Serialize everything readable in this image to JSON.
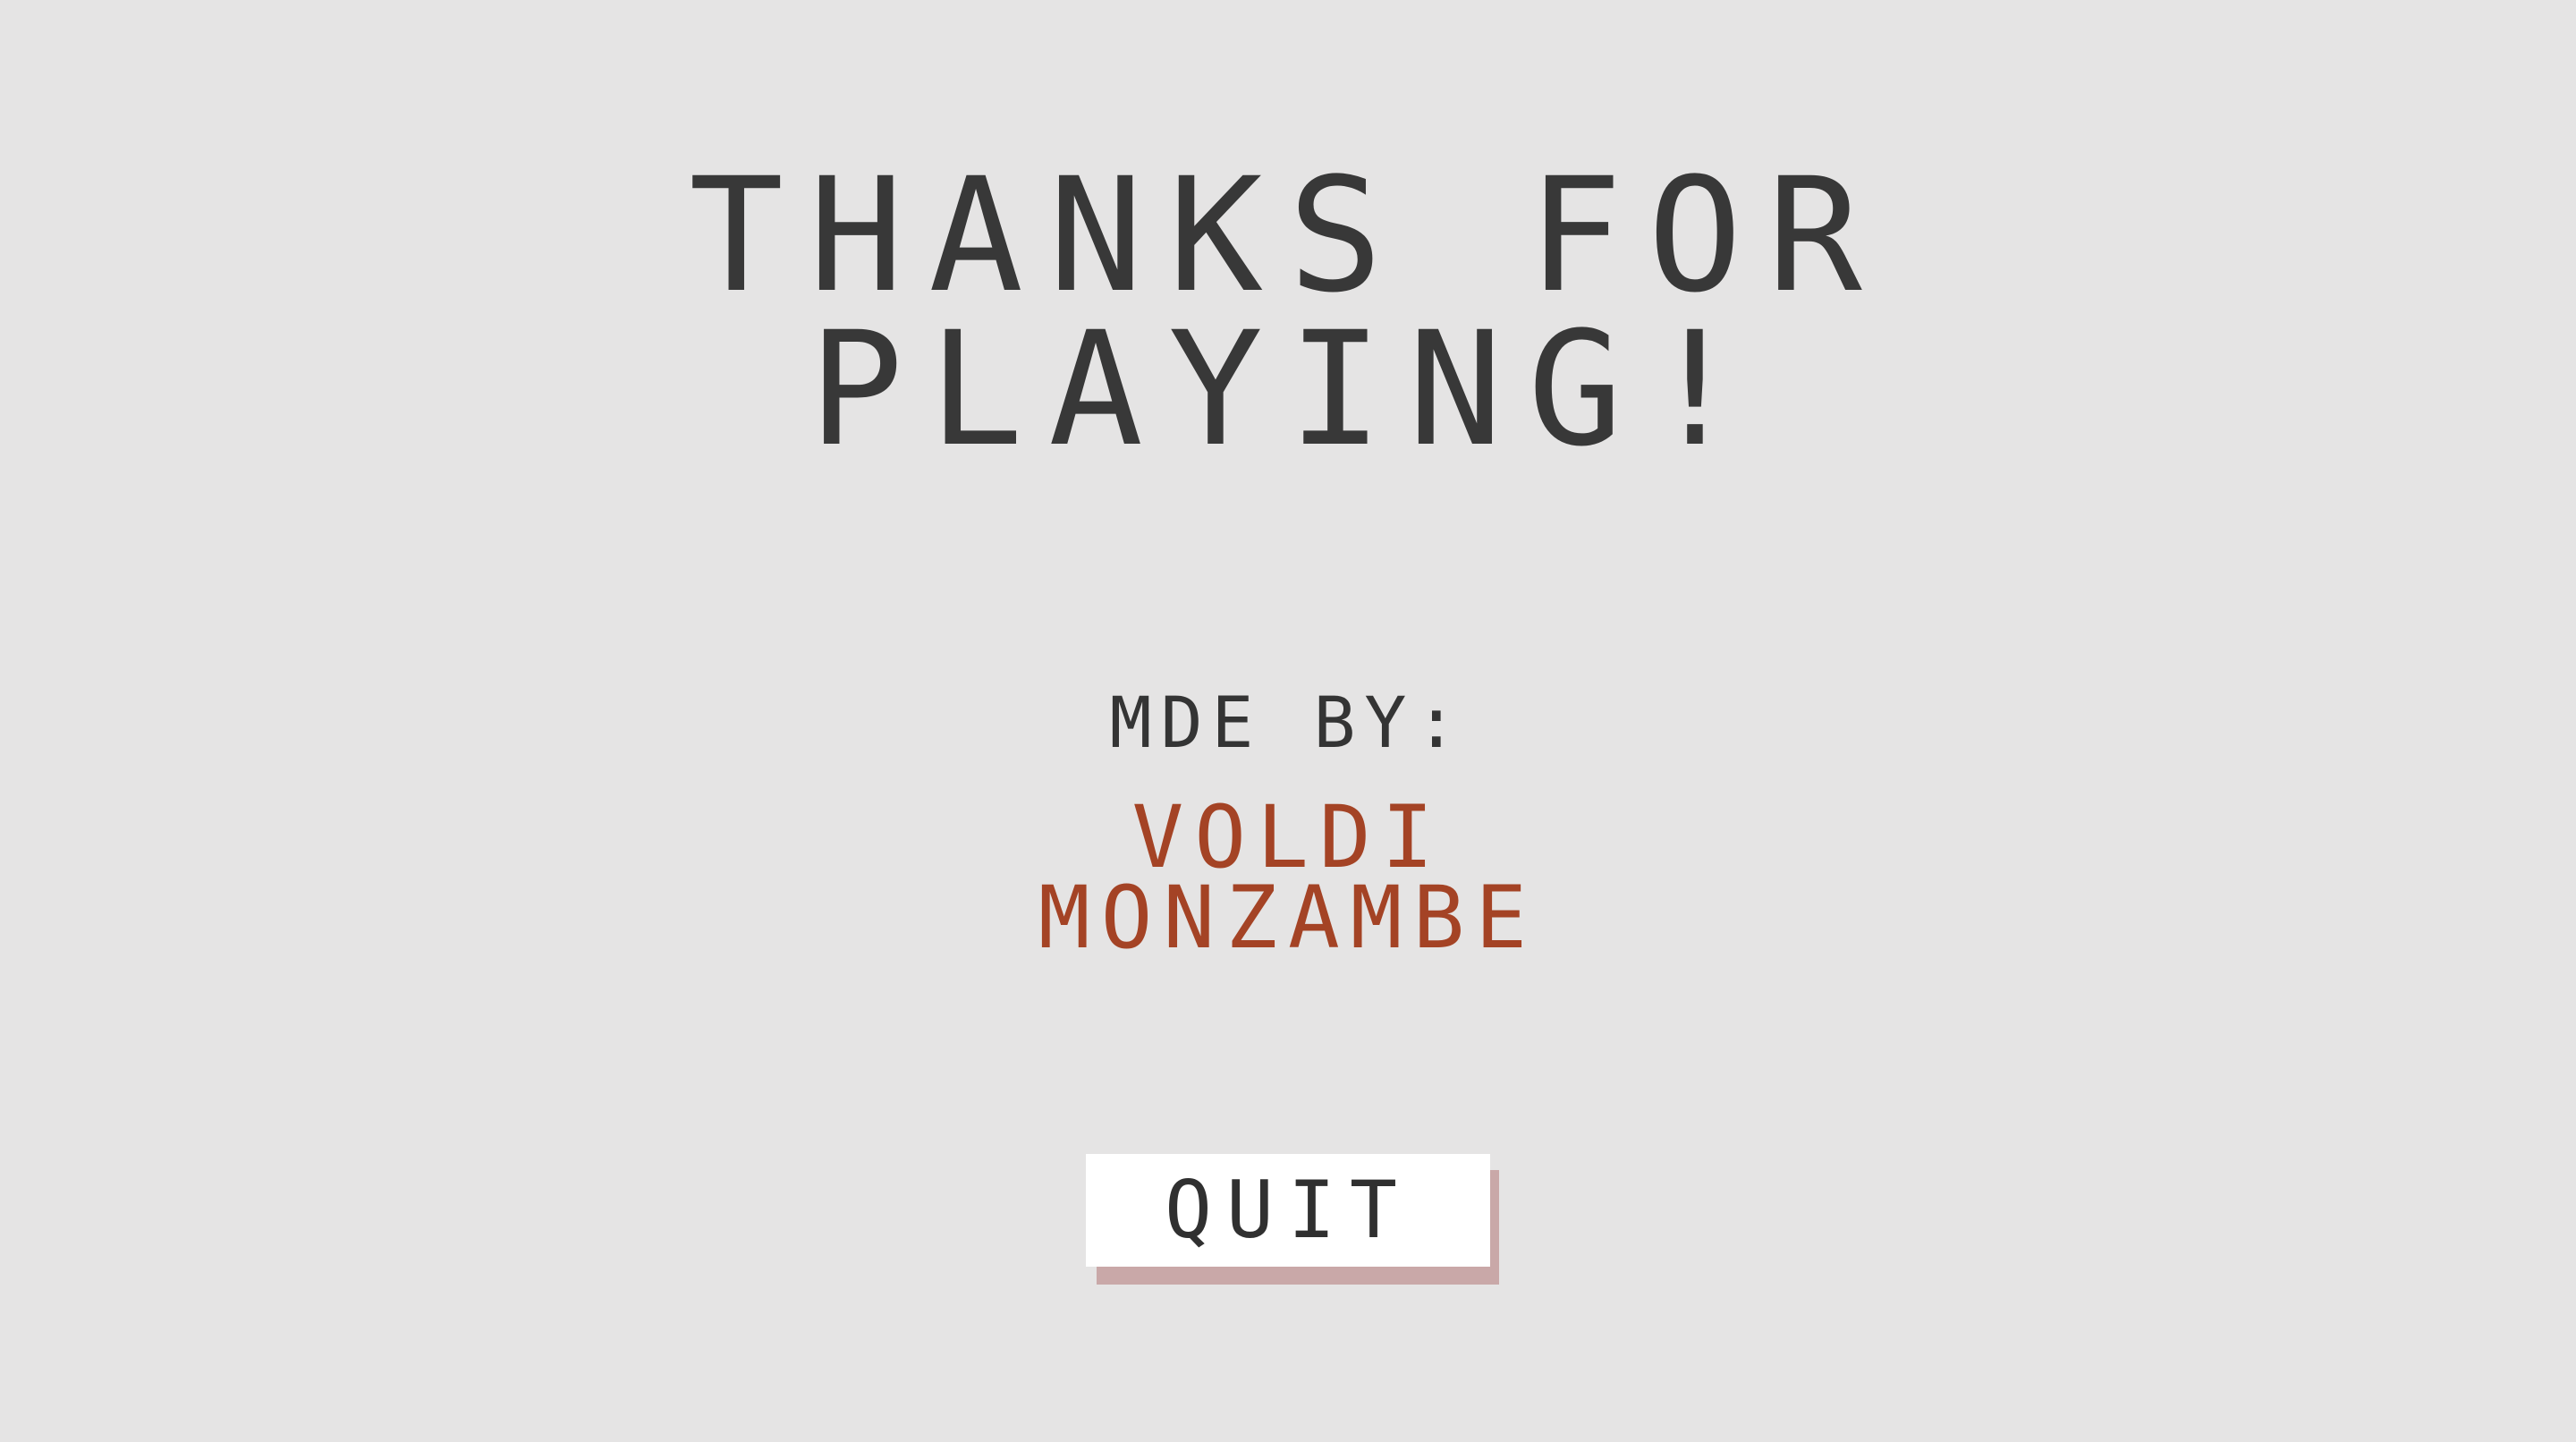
{
  "ending_screen": {
    "title_line_1": "THANKS FOR",
    "title_line_2": "PLAYING!",
    "made_by_label": "MDE BY:",
    "author_line_1": "VOLDI",
    "author_line_2": "MONZAMBE",
    "quit_label": "QUIT",
    "colors": {
      "background": "#e5e4e4",
      "title": "#383838",
      "author": "#a44325",
      "button": "#ffffff",
      "button_shadow": "#c9a8a8"
    }
  }
}
